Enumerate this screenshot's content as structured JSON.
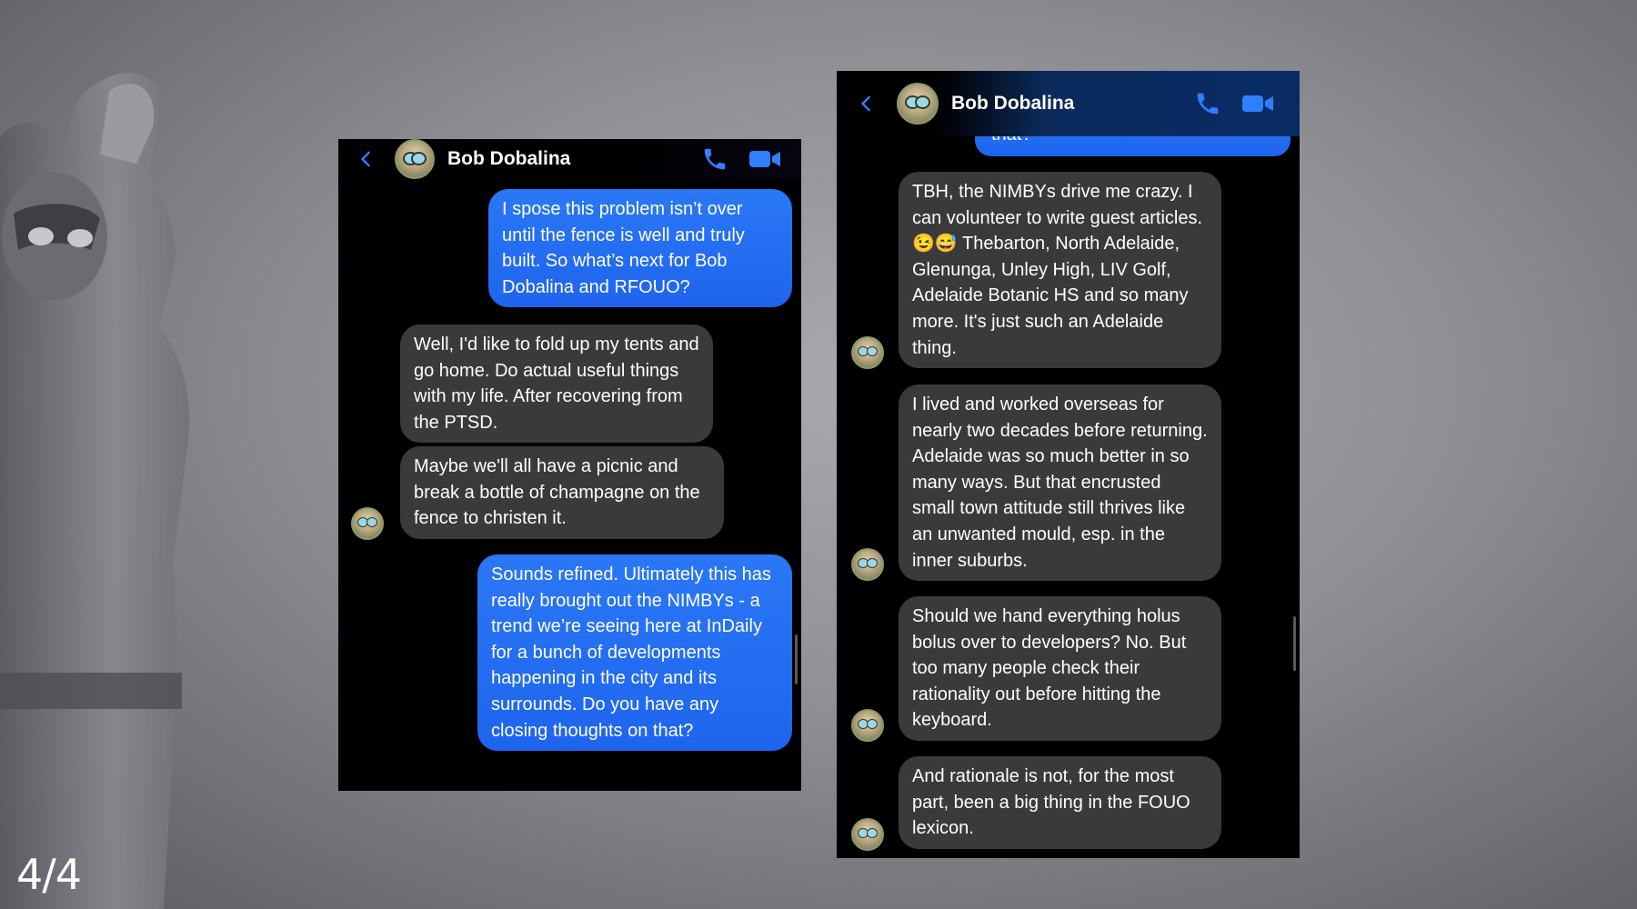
{
  "page_counter": "4/4",
  "colors": {
    "accent_blue": "#2a78f6",
    "incoming_bubble": "#3a3a3c",
    "header_icon_blue": "#2f80ff"
  },
  "icons": {
    "back": "chevron-left-icon",
    "call": "phone-icon",
    "video": "video-camera-icon"
  },
  "left_chat": {
    "contact_name": "Bob Dobalina",
    "messages": [
      {
        "direction": "out",
        "text": "I spose this problem isn’t over until the fence is well and truly built. So what’s next for Bob Dobalina and RFOUO?"
      },
      {
        "direction": "in",
        "text": "Well, I'd like to fold up my tents and go home. Do actual useful things with my life. After recovering from the PTSD."
      },
      {
        "direction": "in",
        "text": "Maybe we'll all have a picnic and break a bottle of champagne on the fence to christen it."
      },
      {
        "direction": "out",
        "text": "Sounds refined. Ultimately this has really brought out the NIMBYs - a trend we’re seeing here at InDaily for a bunch of developments happening in the city and its surrounds. Do you have any closing thoughts on that?"
      }
    ]
  },
  "right_chat": {
    "contact_name": "Bob Dobalina",
    "partial_top_text": "that?",
    "messages": [
      {
        "direction": "in",
        "text": "TBH, the NIMBYs drive me crazy. I can volunteer to write guest articles. 😉😅 Thebarton, North Adelaide, Glenunga, Unley High, LIV Golf, Adelaide Botanic HS and so many more. It's just such an Adelaide thing."
      },
      {
        "direction": "in",
        "text": "I lived and worked overseas for nearly two decades before returning. Adelaide was so much better in so many ways. But that encrusted small town attitude still thrives like an unwanted mould, esp. in the inner suburbs."
      },
      {
        "direction": "in",
        "text": "Should we hand everything holus bolus over to developers? No. But too many people check their rationality out before hitting the keyboard."
      },
      {
        "direction": "in",
        "text": "And rationale is not, for the most part, been a big thing in the FOUO lexicon."
      }
    ]
  }
}
